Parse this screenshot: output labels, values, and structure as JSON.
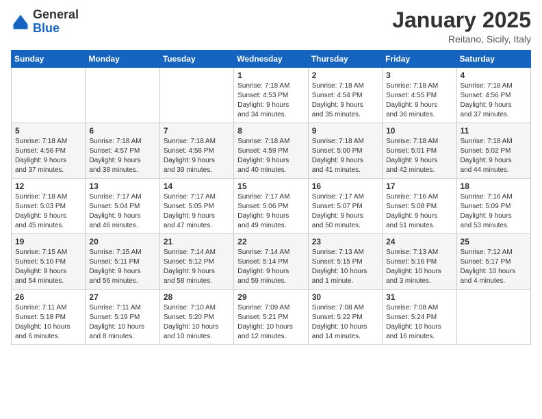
{
  "logo": {
    "general": "General",
    "blue": "Blue"
  },
  "header": {
    "month": "January 2025",
    "location": "Reitano, Sicily, Italy"
  },
  "weekdays": [
    "Sunday",
    "Monday",
    "Tuesday",
    "Wednesday",
    "Thursday",
    "Friday",
    "Saturday"
  ],
  "weeks": [
    [
      {
        "day": "",
        "info": ""
      },
      {
        "day": "",
        "info": ""
      },
      {
        "day": "",
        "info": ""
      },
      {
        "day": "1",
        "info": "Sunrise: 7:18 AM\nSunset: 4:53 PM\nDaylight: 9 hours\nand 34 minutes."
      },
      {
        "day": "2",
        "info": "Sunrise: 7:18 AM\nSunset: 4:54 PM\nDaylight: 9 hours\nand 35 minutes."
      },
      {
        "day": "3",
        "info": "Sunrise: 7:18 AM\nSunset: 4:55 PM\nDaylight: 9 hours\nand 36 minutes."
      },
      {
        "day": "4",
        "info": "Sunrise: 7:18 AM\nSunset: 4:56 PM\nDaylight: 9 hours\nand 37 minutes."
      }
    ],
    [
      {
        "day": "5",
        "info": "Sunrise: 7:18 AM\nSunset: 4:56 PM\nDaylight: 9 hours\nand 37 minutes."
      },
      {
        "day": "6",
        "info": "Sunrise: 7:18 AM\nSunset: 4:57 PM\nDaylight: 9 hours\nand 38 minutes."
      },
      {
        "day": "7",
        "info": "Sunrise: 7:18 AM\nSunset: 4:58 PM\nDaylight: 9 hours\nand 39 minutes."
      },
      {
        "day": "8",
        "info": "Sunrise: 7:18 AM\nSunset: 4:59 PM\nDaylight: 9 hours\nand 40 minutes."
      },
      {
        "day": "9",
        "info": "Sunrise: 7:18 AM\nSunset: 5:00 PM\nDaylight: 9 hours\nand 41 minutes."
      },
      {
        "day": "10",
        "info": "Sunrise: 7:18 AM\nSunset: 5:01 PM\nDaylight: 9 hours\nand 42 minutes."
      },
      {
        "day": "11",
        "info": "Sunrise: 7:18 AM\nSunset: 5:02 PM\nDaylight: 9 hours\nand 44 minutes."
      }
    ],
    [
      {
        "day": "12",
        "info": "Sunrise: 7:18 AM\nSunset: 5:03 PM\nDaylight: 9 hours\nand 45 minutes."
      },
      {
        "day": "13",
        "info": "Sunrise: 7:17 AM\nSunset: 5:04 PM\nDaylight: 9 hours\nand 46 minutes."
      },
      {
        "day": "14",
        "info": "Sunrise: 7:17 AM\nSunset: 5:05 PM\nDaylight: 9 hours\nand 47 minutes."
      },
      {
        "day": "15",
        "info": "Sunrise: 7:17 AM\nSunset: 5:06 PM\nDaylight: 9 hours\nand 49 minutes."
      },
      {
        "day": "16",
        "info": "Sunrise: 7:17 AM\nSunset: 5:07 PM\nDaylight: 9 hours\nand 50 minutes."
      },
      {
        "day": "17",
        "info": "Sunrise: 7:16 AM\nSunset: 5:08 PM\nDaylight: 9 hours\nand 51 minutes."
      },
      {
        "day": "18",
        "info": "Sunrise: 7:16 AM\nSunset: 5:09 PM\nDaylight: 9 hours\nand 53 minutes."
      }
    ],
    [
      {
        "day": "19",
        "info": "Sunrise: 7:15 AM\nSunset: 5:10 PM\nDaylight: 9 hours\nand 54 minutes."
      },
      {
        "day": "20",
        "info": "Sunrise: 7:15 AM\nSunset: 5:11 PM\nDaylight: 9 hours\nand 56 minutes."
      },
      {
        "day": "21",
        "info": "Sunrise: 7:14 AM\nSunset: 5:12 PM\nDaylight: 9 hours\nand 58 minutes."
      },
      {
        "day": "22",
        "info": "Sunrise: 7:14 AM\nSunset: 5:14 PM\nDaylight: 9 hours\nand 59 minutes."
      },
      {
        "day": "23",
        "info": "Sunrise: 7:13 AM\nSunset: 5:15 PM\nDaylight: 10 hours\nand 1 minute."
      },
      {
        "day": "24",
        "info": "Sunrise: 7:13 AM\nSunset: 5:16 PM\nDaylight: 10 hours\nand 3 minutes."
      },
      {
        "day": "25",
        "info": "Sunrise: 7:12 AM\nSunset: 5:17 PM\nDaylight: 10 hours\nand 4 minutes."
      }
    ],
    [
      {
        "day": "26",
        "info": "Sunrise: 7:11 AM\nSunset: 5:18 PM\nDaylight: 10 hours\nand 6 minutes."
      },
      {
        "day": "27",
        "info": "Sunrise: 7:11 AM\nSunset: 5:19 PM\nDaylight: 10 hours\nand 8 minutes."
      },
      {
        "day": "28",
        "info": "Sunrise: 7:10 AM\nSunset: 5:20 PM\nDaylight: 10 hours\nand 10 minutes."
      },
      {
        "day": "29",
        "info": "Sunrise: 7:09 AM\nSunset: 5:21 PM\nDaylight: 10 hours\nand 12 minutes."
      },
      {
        "day": "30",
        "info": "Sunrise: 7:08 AM\nSunset: 5:22 PM\nDaylight: 10 hours\nand 14 minutes."
      },
      {
        "day": "31",
        "info": "Sunrise: 7:08 AM\nSunset: 5:24 PM\nDaylight: 10 hours\nand 16 minutes."
      },
      {
        "day": "",
        "info": ""
      }
    ]
  ]
}
